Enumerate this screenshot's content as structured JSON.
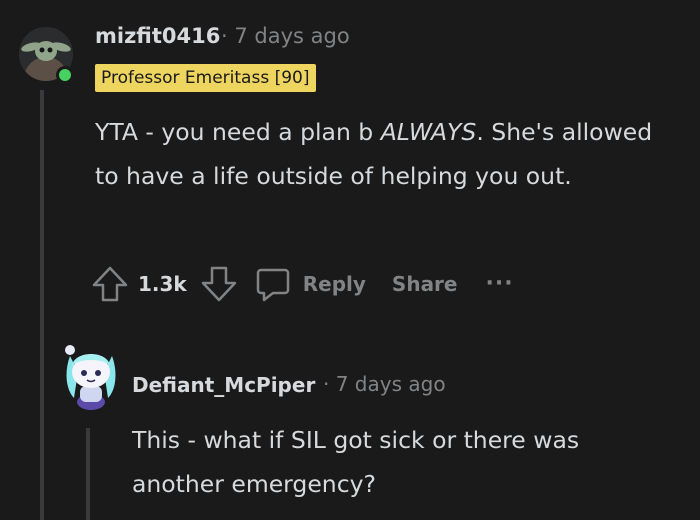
{
  "comment": {
    "username": "mizfit0416",
    "time": "· 7 days ago",
    "flair": "Professor Emeritass [90]",
    "body_prefix": "YTA - you need a plan b ",
    "body_emphasis": "ALWAYS",
    "body_suffix": ". She's allowed to have a life outside of helping you out.",
    "votes": "1.3k",
    "reply_label": "Reply",
    "share_label": "Share",
    "more_label": "···"
  },
  "reply": {
    "username": "Defiant_McPiper",
    "time": "· 7 days ago",
    "body": "This - what if SIL got sick or there was another emergency?"
  },
  "colors": {
    "background": "#1a1a1b",
    "flair": "#eed55f",
    "online": "#46d160",
    "muted": "#818384",
    "text": "#d7dadc"
  }
}
